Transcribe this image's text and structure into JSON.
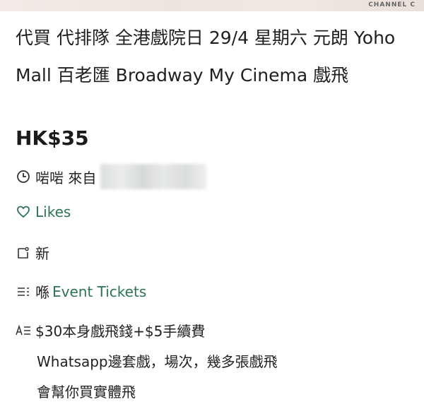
{
  "header": {
    "watermark": "CHANNEL C"
  },
  "listing": {
    "title": "代買 代排隊 全港戲院日 29/4 星期六 元朗 Yoho Mall 百老匯 Broadway My Cinema 戲飛",
    "price": "HK$35",
    "seller_prefix": "啱啱 來自",
    "likes_label": "Likes",
    "condition": "新",
    "category_prefix": "喺",
    "category": "Event Tickets",
    "description_lines": [
      "$30本身戲飛錢+$5手續費",
      "Whatsapp邊套戲，場次，幾多張戲飛",
      "會幫你買實體飛"
    ]
  },
  "colors": {
    "accent_green": "#2d7355",
    "text": "#222222"
  },
  "icons": {
    "time": "clock-icon",
    "likes": "heart-icon",
    "condition": "tag-icon",
    "category": "list-icon",
    "description": "text-format-icon"
  }
}
